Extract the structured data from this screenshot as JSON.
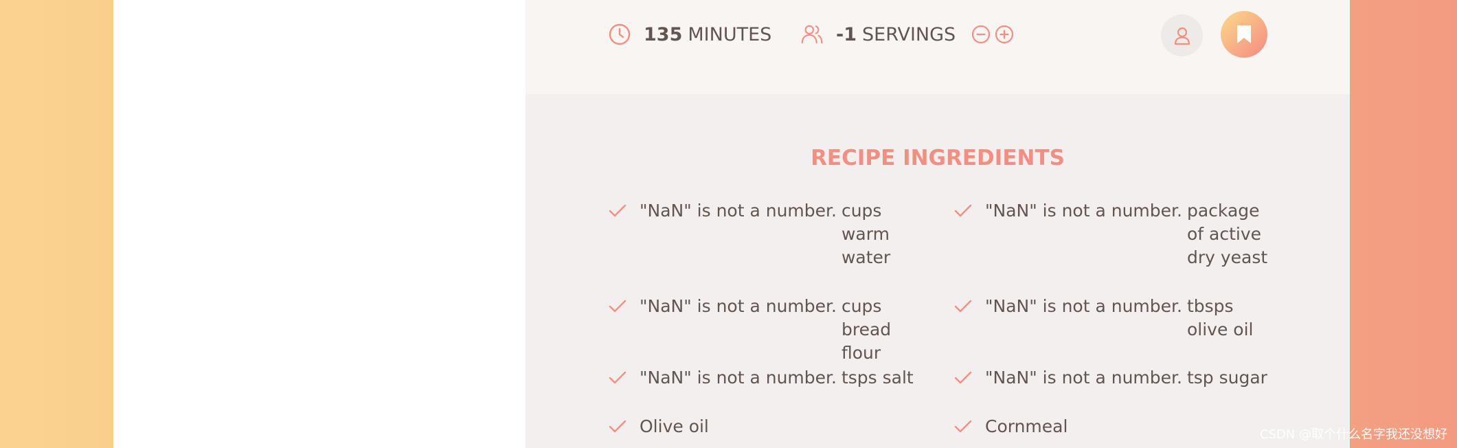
{
  "details": {
    "time_value": "135",
    "time_unit": "MINUTES",
    "servings_value": "-1",
    "servings_unit": "SERVINGS"
  },
  "icons": {
    "clock": "clock-icon",
    "users": "users-icon",
    "minus": "minus-circle-icon",
    "plus": "plus-circle-icon",
    "user": "user-icon",
    "bookmark": "bookmark-icon",
    "check": "check-icon"
  },
  "colors": {
    "accent": "#f38e82",
    "text": "#615551",
    "panel": "#f2efee",
    "bar": "#f9f5f3"
  },
  "ingredients": {
    "title": "RECIPE INGREDIENTS",
    "items": [
      {
        "quantity": "\"NaN\" is not a number.",
        "description": "cups warm water"
      },
      {
        "quantity": "\"NaN\" is not a number.",
        "description": "package of active dry yeast"
      },
      {
        "quantity": "\"NaN\" is not a number.",
        "description": "cups bread flour"
      },
      {
        "quantity": "\"NaN\" is not a number.",
        "description": "tbsps olive oil"
      },
      {
        "quantity": "\"NaN\" is not a number.",
        "description": "tsps salt"
      },
      {
        "quantity": "\"NaN\" is not a number.",
        "description": "tsp sugar"
      },
      {
        "quantity": "",
        "description": "Olive oil"
      },
      {
        "quantity": "",
        "description": "Cornmeal"
      }
    ]
  },
  "watermark": "CSDN @取个什么名字我还没想好"
}
